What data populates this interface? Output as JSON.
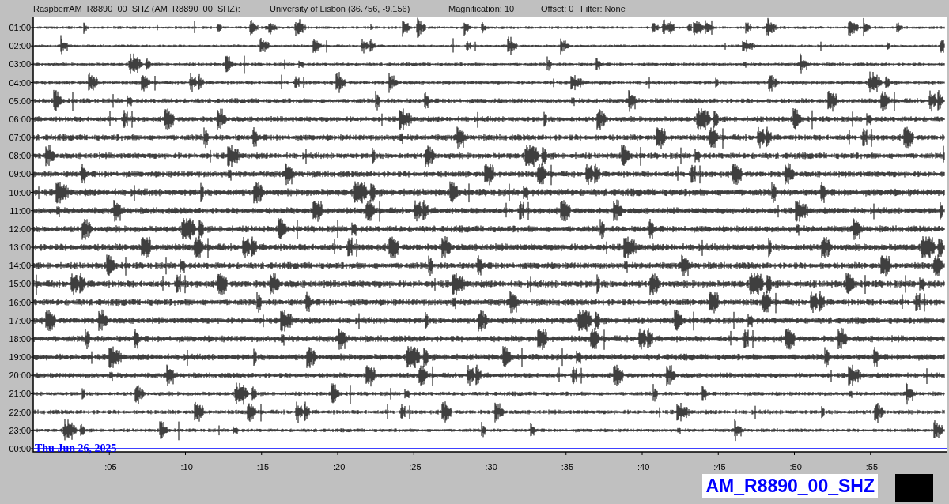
{
  "header": {
    "station": "RaspberrAM_R8890_00_SHZ (AM_R8890_00_SHZ):",
    "location": "University of Lisbon (36.756, -9.156)",
    "magnification": "Magnification: 10",
    "offset": "Offset: 0",
    "filter": "Filter: None"
  },
  "helicorder": {
    "rows": [
      {
        "time": "01:00",
        "kind": "trace"
      },
      {
        "time": "02:00",
        "kind": "trace"
      },
      {
        "time": "03:00",
        "kind": "trace"
      },
      {
        "time": "04:00",
        "kind": "trace"
      },
      {
        "time": "05:00",
        "kind": "trace"
      },
      {
        "time": "06:00",
        "kind": "trace"
      },
      {
        "time": "07:00",
        "kind": "trace"
      },
      {
        "time": "08:00",
        "kind": "trace"
      },
      {
        "time": "09:00",
        "kind": "trace"
      },
      {
        "time": "10:00",
        "kind": "trace"
      },
      {
        "time": "11:00",
        "kind": "trace"
      },
      {
        "time": "12:00",
        "kind": "trace"
      },
      {
        "time": "13:00",
        "kind": "trace"
      },
      {
        "time": "14:00",
        "kind": "trace"
      },
      {
        "time": "15:00",
        "kind": "trace"
      },
      {
        "time": "16:00",
        "kind": "trace"
      },
      {
        "time": "17:00",
        "kind": "trace"
      },
      {
        "time": "18:00",
        "kind": "trace"
      },
      {
        "time": "19:00",
        "kind": "trace"
      },
      {
        "time": "20:00",
        "kind": "trace"
      },
      {
        "time": "21:00",
        "kind": "trace"
      },
      {
        "time": "22:00",
        "kind": "trace"
      },
      {
        "time": "23:00",
        "kind": "trace"
      },
      {
        "time": "00:00",
        "kind": "current"
      }
    ],
    "date_label": "Thu Jun 26, 2025",
    "x_ticks": [
      ":05",
      ":10",
      ":15",
      ":20",
      ":25",
      ":30",
      ":35",
      ":40",
      ":45",
      ":50",
      ":55"
    ]
  },
  "channel_label": "AM_R8890_00_SHZ"
}
